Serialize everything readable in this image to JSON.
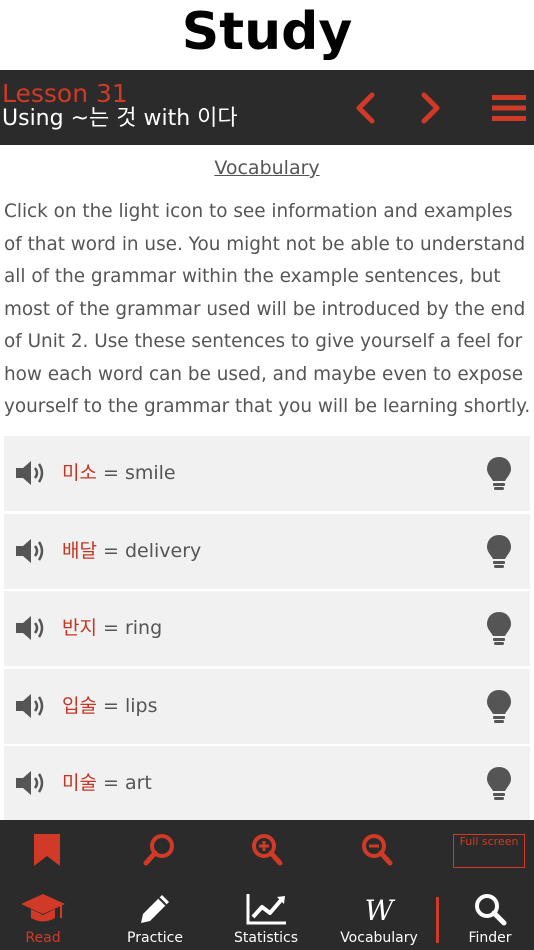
{
  "page_title": "Study",
  "lesson": {
    "number": "Lesson 31",
    "subtitle": "Using ~는 것 with 이다"
  },
  "vocabulary_heading": "Vocabulary",
  "intro_text": "Click on the light icon to see information and examples of that word in use. You might not be able to understand all of the grammar within the example sentences, but most of the grammar used will be introduced by the end of Unit 2. Use these sentences to give yourself a feel for how each word can be used, and maybe even to expose yourself to the grammar that you will be learning shortly.",
  "vocab_items": [
    {
      "korean": "미소",
      "english": " = smile"
    },
    {
      "korean": "배달",
      "english": " = delivery"
    },
    {
      "korean": "반지",
      "english": " = ring"
    },
    {
      "korean": "입술",
      "english": " = lips"
    },
    {
      "korean": "미술",
      "english": " = art"
    }
  ],
  "toolbar": {
    "fullscreen_label": "Full screen"
  },
  "bottom_nav": [
    {
      "label": "Read"
    },
    {
      "label": "Practice"
    },
    {
      "label": "Statistics"
    },
    {
      "label": "Vocabulary"
    },
    {
      "label": "Finder"
    }
  ],
  "colors": {
    "accent": "#d13a26",
    "header_bg": "#2b2b2b",
    "row_bg": "#f1f1f1"
  }
}
